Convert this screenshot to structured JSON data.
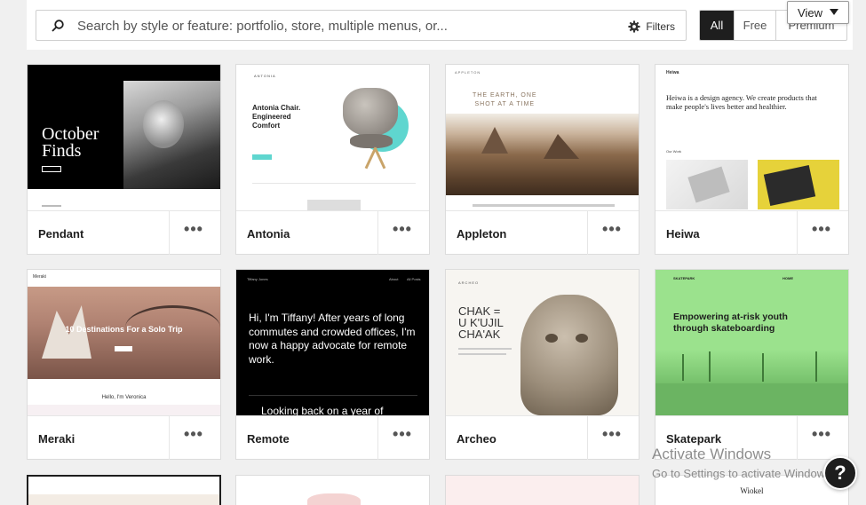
{
  "search": {
    "placeholder": "Search by style or feature: portfolio, store, multiple menus, or...",
    "filters_label": "Filters"
  },
  "price_filter": {
    "all": "All",
    "free": "Free",
    "premium": "Premium"
  },
  "view_button": {
    "label": "View"
  },
  "themes": [
    {
      "name": "Pendant",
      "preview": {
        "headline_1": "October",
        "headline_2": "Finds"
      }
    },
    {
      "name": "Antonia",
      "preview": {
        "brand": "ANTONIA",
        "headline_1": "Antonia Chair.",
        "headline_2": "Engineered",
        "headline_3": "Comfort"
      }
    },
    {
      "name": "Appleton",
      "preview": {
        "brand": "APPLETON",
        "headline_1": "THE EARTH, ONE",
        "headline_2": "SHOT AT A TIME"
      }
    },
    {
      "name": "Heiwa",
      "preview": {
        "brand": "Heiwa",
        "headline": "Heiwa is a design agency. We create products that make people's lives better and healthier.",
        "section": "Our Work"
      }
    },
    {
      "name": "Meraki",
      "preview": {
        "brand": "Meraki",
        "headline": "10 Destinations For a Solo Trip",
        "greeting": "Hello, I'm Veronica"
      }
    },
    {
      "name": "Remote",
      "preview": {
        "brand": "Tiffany Jones",
        "nav_1": "About",
        "nav_2": "All Posts",
        "headline": "Hi, I'm Tiffany! After years of long commutes and crowded offices, I'm now a happy advocate for remote work.",
        "subline": "Looking back on a year of"
      }
    },
    {
      "name": "Archeo",
      "preview": {
        "brand": "ARCHEO",
        "headline_1": "CHAK =",
        "headline_2": "U K'UJIL",
        "headline_3": "CHA'AK"
      }
    },
    {
      "name": "Skatepark",
      "preview": {
        "brand": "SKATEPARK",
        "nav": "HOME",
        "headline_1": "Empowering at-risk youth",
        "headline_2": "through skateboarding"
      }
    }
  ],
  "next_row": {
    "wiokel": "Wiokel"
  },
  "watermark": {
    "line1": "Activate Windows",
    "line2": "Go to Settings to activate Windows."
  },
  "help_button": {
    "label": "?"
  },
  "colors": {
    "accent_dark": "#1e1e1e",
    "skatepark_green": "#9be28d",
    "antonia_teal": "#5fd6cf"
  }
}
